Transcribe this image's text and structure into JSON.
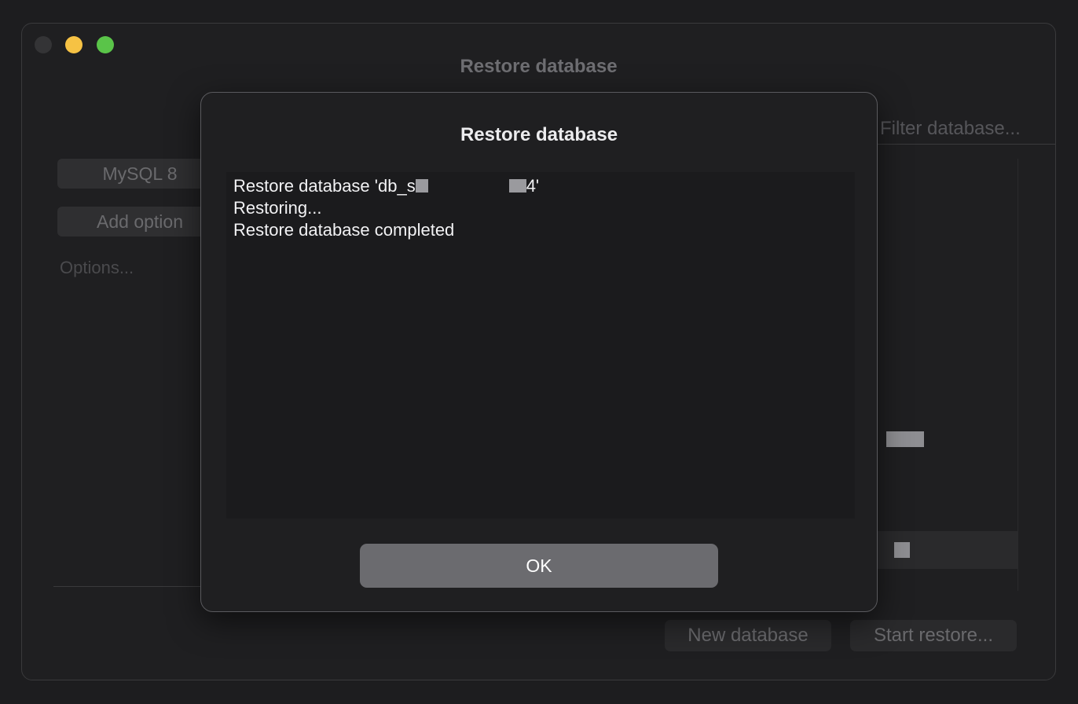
{
  "window": {
    "title": "Restore database",
    "traffic_lights": [
      "close",
      "minimize",
      "maximize"
    ]
  },
  "background": {
    "server_button": "MySQL 8",
    "add_option_button": "Add option",
    "options_placeholder": "Options...",
    "database_search_placeholder": "Filter database...",
    "new_database_button": "New database",
    "start_restore_button": "Start restore..."
  },
  "dialog": {
    "title": "Restore database",
    "log": {
      "line1_prefix": "Restore database 'db_s",
      "line1_suffix": "4'",
      "line2": "Restoring...",
      "line3": "Restore database completed"
    },
    "ok_label": "OK"
  }
}
